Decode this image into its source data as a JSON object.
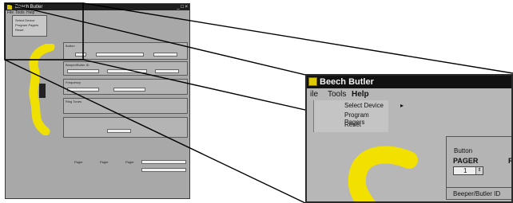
{
  "small_window": {
    "title": "Beech Butler",
    "controls": "_ □ ×",
    "menu": [
      "File",
      "Tools",
      "Help"
    ],
    "dropdown": [
      "Select Device",
      "Program Pagers",
      "Reset"
    ],
    "panel_texts": [
      "Button",
      "PAGER",
      "Beeper/Butler ID",
      "Frequency",
      "Ring Tones",
      "Pager",
      "Pager",
      "Pager"
    ]
  },
  "big_window": {
    "title": "Beech Butler",
    "menu": {
      "file": "ile",
      "tools": "Tools",
      "help": "Help"
    },
    "dropdown": {
      "select_device": "Select Device",
      "arrow": "▸",
      "program_pagers": "Program Pagers",
      "reset": "Reset"
    },
    "panel": {
      "group_label": "Button",
      "pager_label": "PAGER",
      "right_label": "R",
      "stepper_value": "1",
      "stepper_arrow": "⇕",
      "id_label": "Beeper/Butler ID"
    }
  },
  "colors": {
    "window_bg": "#b7b7b7",
    "titlebar": "#121212",
    "accent_yellow": "#f0e000"
  }
}
